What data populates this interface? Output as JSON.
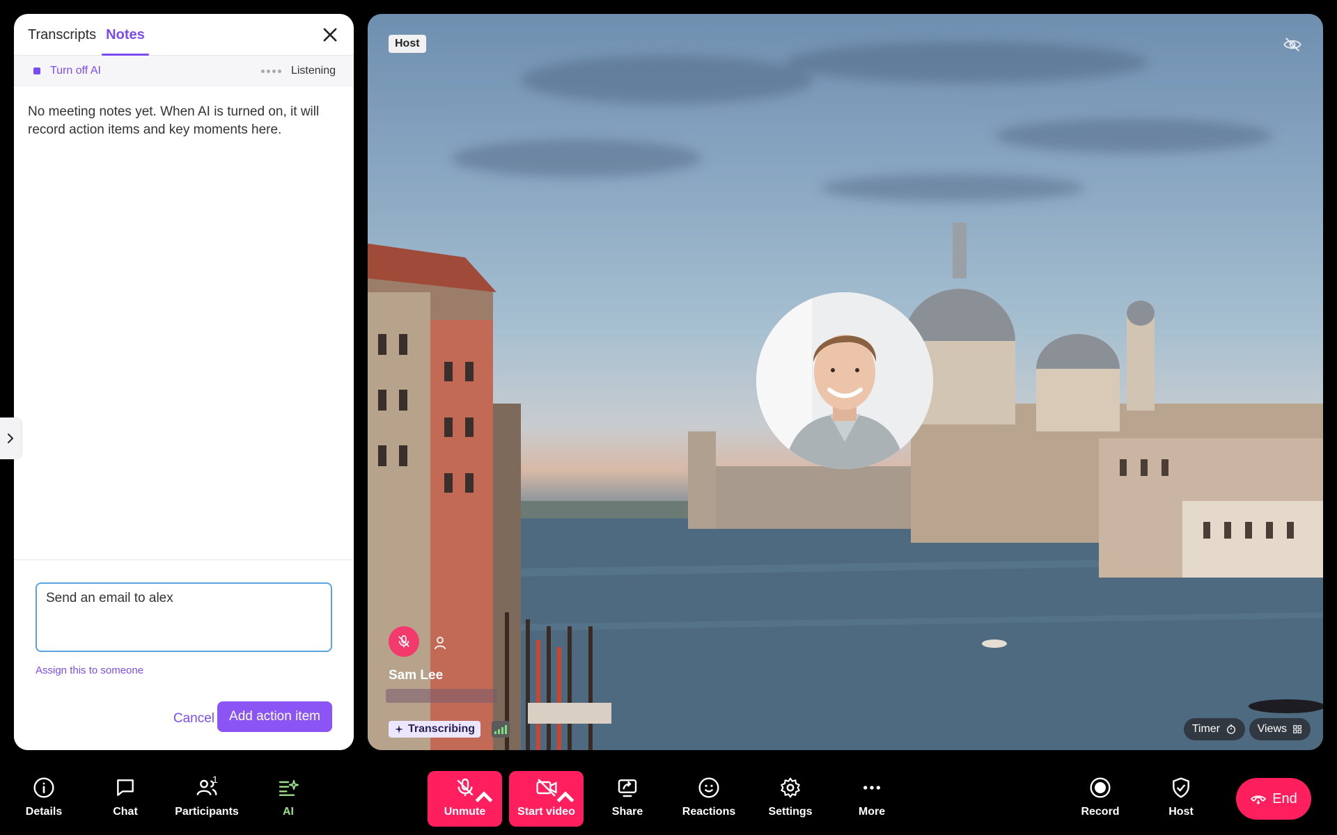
{
  "panel": {
    "tabs": [
      {
        "label": "Transcripts"
      },
      {
        "label": "Notes"
      }
    ],
    "ai_toggle_label": "Turn off AI",
    "status": "Listening",
    "empty_text": "No meeting notes yet. When AI is turned on, it will record action items and key moments here.",
    "note_input_value": "Send an email to alex",
    "assign_link": "Assign this to someone",
    "cancel_label": "Cancel",
    "add_label": "Add action item"
  },
  "stage": {
    "host_badge": "Host",
    "participant_name": "Sam Lee",
    "transcribing": "Transcribing",
    "timer_label": "Timer",
    "views_label": "Views"
  },
  "toolbar": {
    "details": "Details",
    "chat": "Chat",
    "participants": "Participants",
    "participants_count": "1",
    "ai": "AI",
    "unmute": "Unmute",
    "start_video": "Start video",
    "share": "Share",
    "reactions": "Reactions",
    "settings": "Settings",
    "more": "More",
    "record": "Record",
    "host": "Host",
    "end": "End"
  },
  "colors": {
    "accent": "#7a4cf0",
    "danger": "#ff1f5e",
    "ai_green": "#9be08a"
  }
}
